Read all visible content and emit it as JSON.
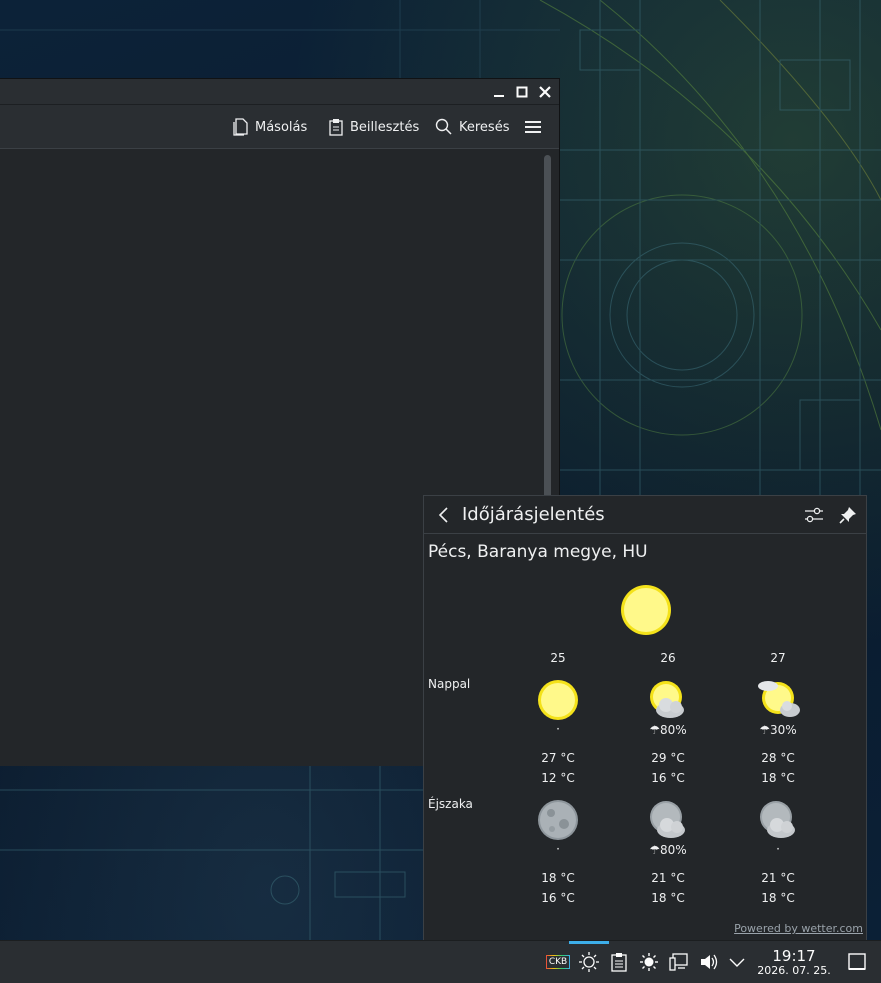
{
  "window": {
    "toolbar": {
      "copy_label": "Másolás",
      "paste_label": "Beillesztés",
      "search_label": "Keresés"
    }
  },
  "weather": {
    "title": "Időjárásjelentés",
    "location": "Pécs, Baranya megye, HU",
    "current_icon": "sun-icon",
    "row_labels": {
      "day": "Nappal",
      "night": "Éjszaka"
    },
    "days": [
      {
        "date": "25",
        "day_icon": "sun-icon",
        "day_precip": "·",
        "day_high": "27 °C",
        "day_low": "12 °C",
        "night_icon": "moon-icon",
        "night_precip": "·",
        "night_high": "18 °C",
        "night_low": "16 °C"
      },
      {
        "date": "26",
        "day_icon": "sun-cloud-icon",
        "day_precip": "☂80%",
        "day_high": "29 °C",
        "day_low": "16 °C",
        "night_icon": "moon-cloud-icon",
        "night_precip": "☂80%",
        "night_high": "21 °C",
        "night_low": "18 °C"
      },
      {
        "date": "27",
        "day_icon": "sun-clouds-icon",
        "day_precip": "☂30%",
        "day_high": "28 °C",
        "day_low": "18 °C",
        "night_icon": "moon-cloud-icon",
        "night_precip": "·",
        "night_high": "21 °C",
        "night_low": "18 °C"
      }
    ],
    "footer": "Powered by wetter.com"
  },
  "taskbar": {
    "keyboard_layout": "CKB",
    "clock_time": "19:17",
    "clock_date": "2026. 07. 25."
  },
  "colors": {
    "accent": "#3daee9",
    "panel_bg": "#232629",
    "sun": "#fff87a",
    "sun_ring": "#f4e21a"
  }
}
